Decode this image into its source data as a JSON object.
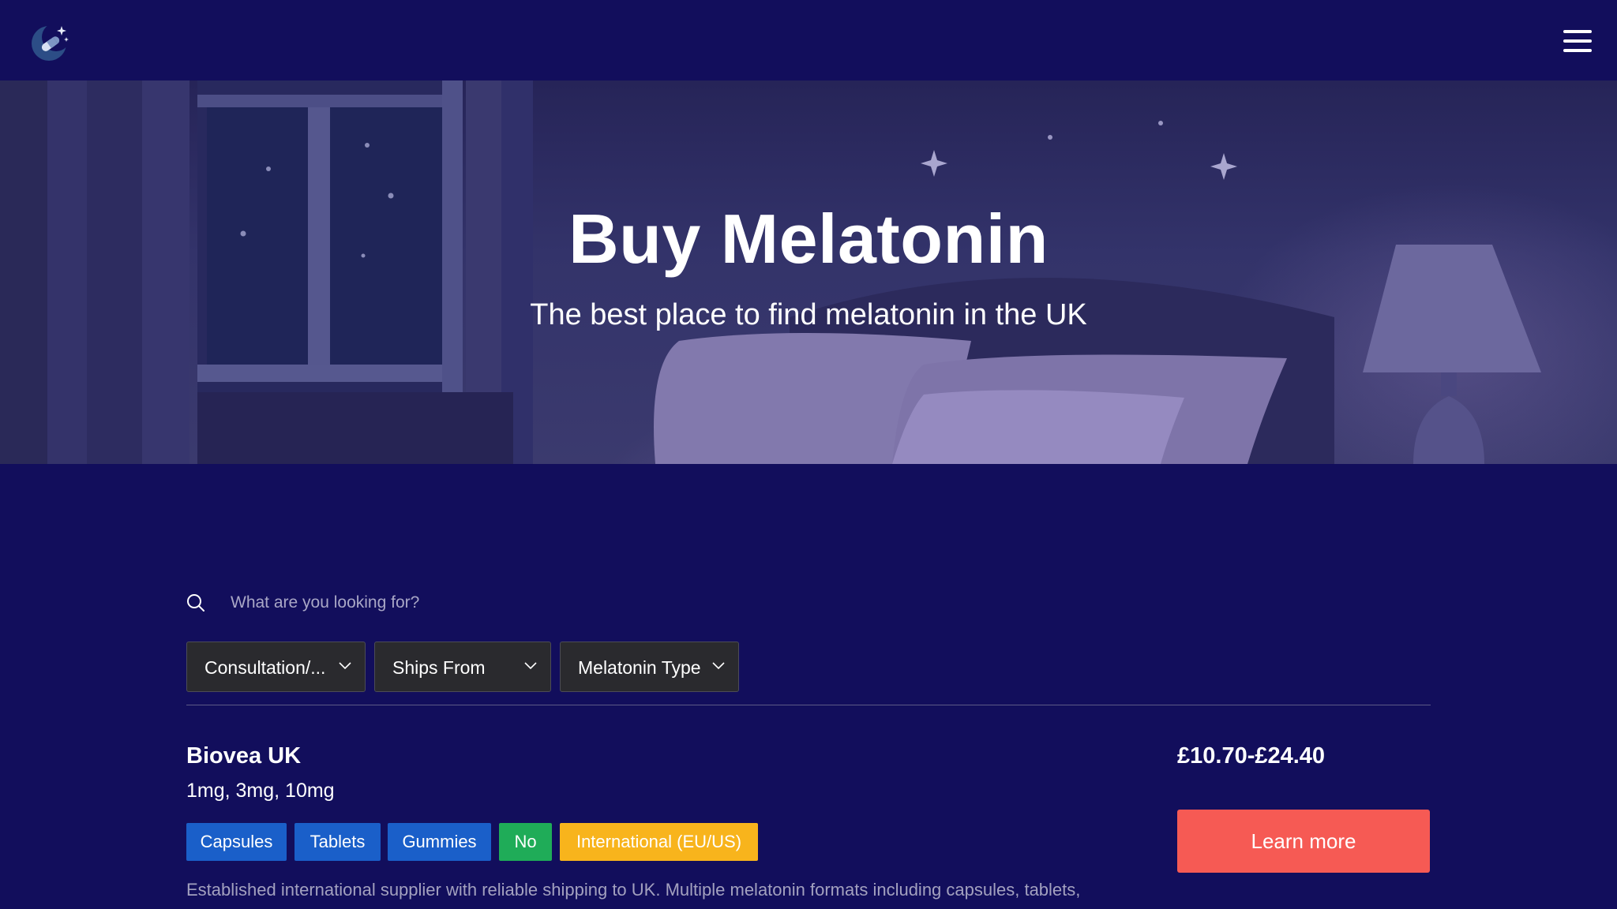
{
  "header": {
    "logo_icon": "moon-stars-capsule-logo",
    "menu_icon": "hamburger-menu-icon"
  },
  "hero": {
    "title": "Buy Melatonin",
    "subtitle": "The best place to find melatonin in the UK"
  },
  "search": {
    "placeholder": "What are you looking for?",
    "icon": "search-icon"
  },
  "filters": [
    {
      "label": "Consultation/..."
    },
    {
      "label": "Ships From"
    },
    {
      "label": "Melatonin Type"
    }
  ],
  "listing": {
    "name": "Biovea UK",
    "doses": "1mg, 3mg, 10mg",
    "price": "£10.70-£24.40",
    "button_label": "Learn more",
    "tags": [
      {
        "label": "Capsules",
        "color": "#1a5fc9"
      },
      {
        "label": "Tablets",
        "color": "#1a5fc9"
      },
      {
        "label": "Gummies",
        "color": "#1a5fc9"
      },
      {
        "label": "No",
        "color": "#1fac58"
      },
      {
        "label": "International (EU/US)",
        "color": "#f8b41c"
      }
    ],
    "description": "Established international supplier with reliable shipping to UK. Multiple melatonin formats including capsules, tablets,"
  },
  "colors": {
    "page_background": "#120e5c",
    "button_accent": "#f65a54",
    "divider": "#5c5a86"
  }
}
